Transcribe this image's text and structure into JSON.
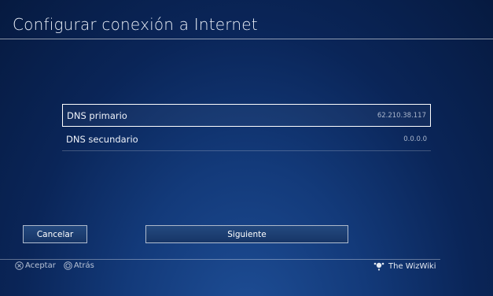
{
  "window": {
    "title": "Configurar conexión a Internet"
  },
  "dns_settings": {
    "rows": [
      {
        "label": "DNS primario",
        "value": "62.210.38.117",
        "selected": true
      },
      {
        "label": "DNS secundario",
        "value": "0.0.0.0",
        "selected": false
      }
    ]
  },
  "buttons": {
    "cancel_label": "Cancelar",
    "next_label": "Siguiente"
  },
  "hints": {
    "accept_icon": "cross-button-icon",
    "accept_label": "Aceptar",
    "back_icon": "circle-button-icon",
    "back_label": "Atrás"
  },
  "watermark": {
    "icon": "wizwiki-logo-icon",
    "text": "The WizWiki"
  },
  "colors": {
    "background_top": "#061a40",
    "background_center": "#133a7a",
    "text": "#ffffff",
    "value_text": "#aab6cc"
  }
}
